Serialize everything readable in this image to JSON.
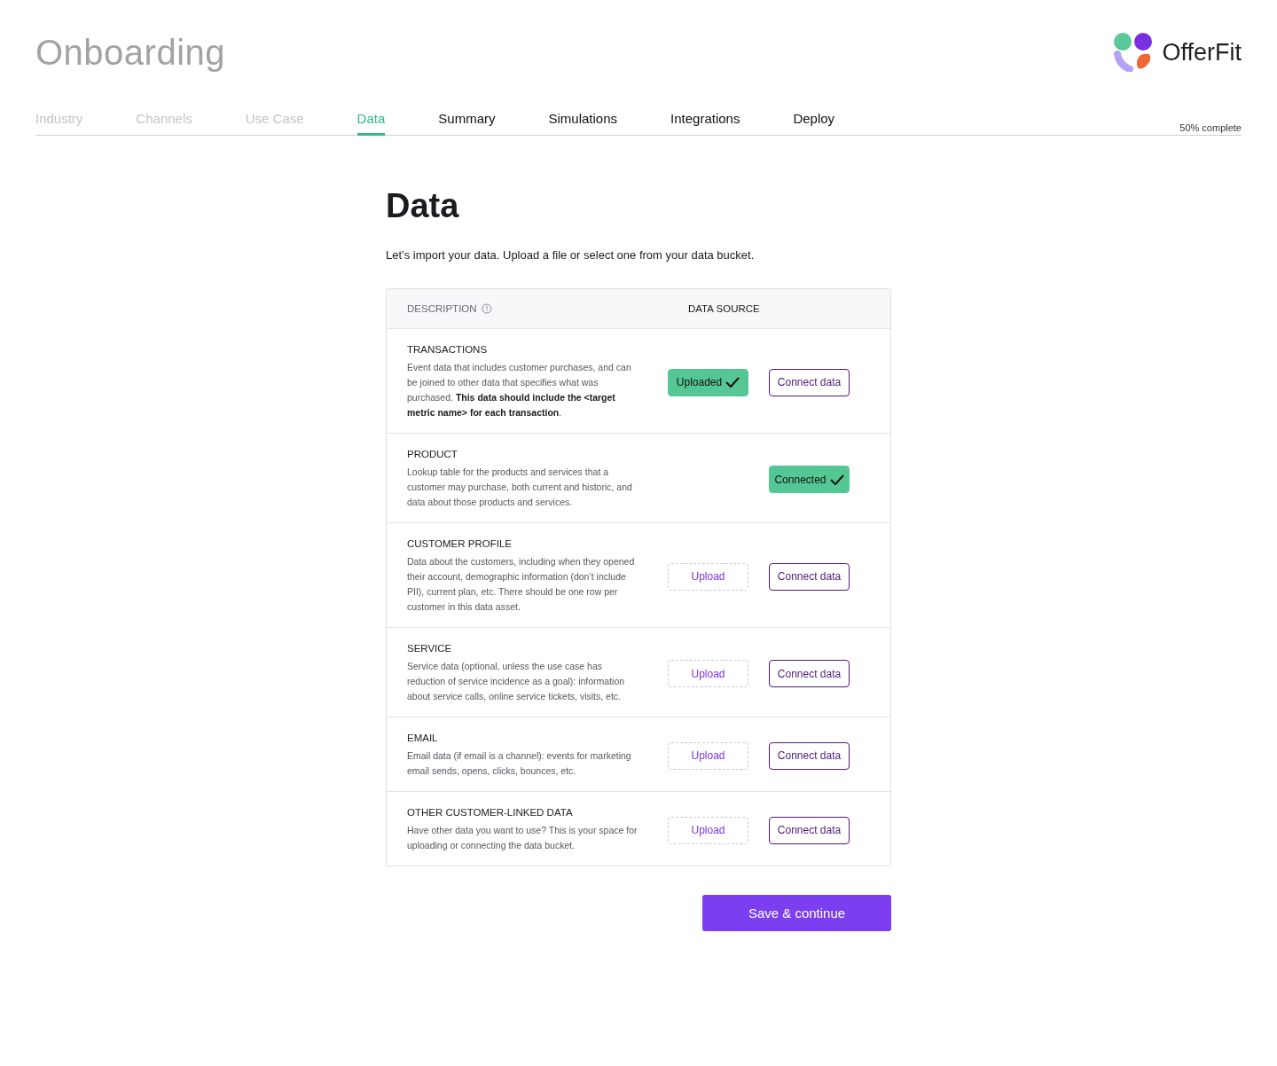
{
  "header": {
    "title": "Onboarding",
    "brand": "OfferFit"
  },
  "tabs": [
    {
      "label": "Industry",
      "selected": false,
      "completed": true
    },
    {
      "label": "Channels",
      "selected": false,
      "completed": true
    },
    {
      "label": "Use Case",
      "selected": false,
      "completed": true
    },
    {
      "label": "Data",
      "selected": true,
      "completed": false
    },
    {
      "label": "Summary",
      "selected": false,
      "completed": false
    },
    {
      "label": "Simulations",
      "selected": false,
      "completed": false
    },
    {
      "label": "Integrations",
      "selected": false,
      "completed": false
    },
    {
      "label": "Deploy",
      "selected": false,
      "completed": false
    }
  ],
  "progress": "50% complete",
  "page": {
    "title": "Data",
    "intro": "Let’s import your data. Upload a file or select one from your data bucket."
  },
  "table": {
    "columns": [
      "DESCRIPTION",
      "DATA SOURCE"
    ],
    "rows": [
      {
        "name": "TRANSACTIONS",
        "description": "Event data that includes customer purchases, and can be joined to other data that specifies what was purchased. **This data should include the <target metric name> for each transaction**.",
        "upload": {
          "label": "Uploaded",
          "done": true
        },
        "connect": {
          "label": "Connect data",
          "done": false
        }
      },
      {
        "name": "PRODUCT",
        "description": "Lookup table for the products and services that a customer may purchase, both current and historic, and data about those products and services.",
        "connect": {
          "label": "Connected",
          "done": true
        }
      },
      {
        "name": "CUSTOMER PROFILE",
        "description": "Data about the customers, including when they opened their account, demographic information (don’t include PII), current plan, etc. There should be one row per customer in this data asset.",
        "upload": {
          "label": "Upload",
          "done": false
        },
        "connect": {
          "label": "Connect data",
          "done": false
        }
      },
      {
        "name": "SERVICE",
        "description": "Service data (optional, unless the use case has reduction of service incidence as a goal): information about service calls, online service tickets, visits, etc.",
        "upload": {
          "label": "Upload",
          "done": false
        },
        "connect": {
          "label": "Connect data",
          "done": false
        }
      },
      {
        "name": "EMAIL",
        "description": "Email data (if email is a channel): events for marketing email sends, opens, clicks, bounces, etc.",
        "upload": {
          "label": "Upload",
          "done": false
        },
        "connect": {
          "label": "Connect data",
          "done": false
        }
      },
      {
        "name": "OTHER CUSTOMER-LINKED DATA",
        "description": "Have other data you want to use? This is your space for uploading or connecting the data bucket.",
        "upload": {
          "label": "Upload",
          "done": false
        },
        "connect": {
          "label": "Connect data",
          "done": false
        }
      }
    ]
  },
  "primary_button": "Save & continue"
}
